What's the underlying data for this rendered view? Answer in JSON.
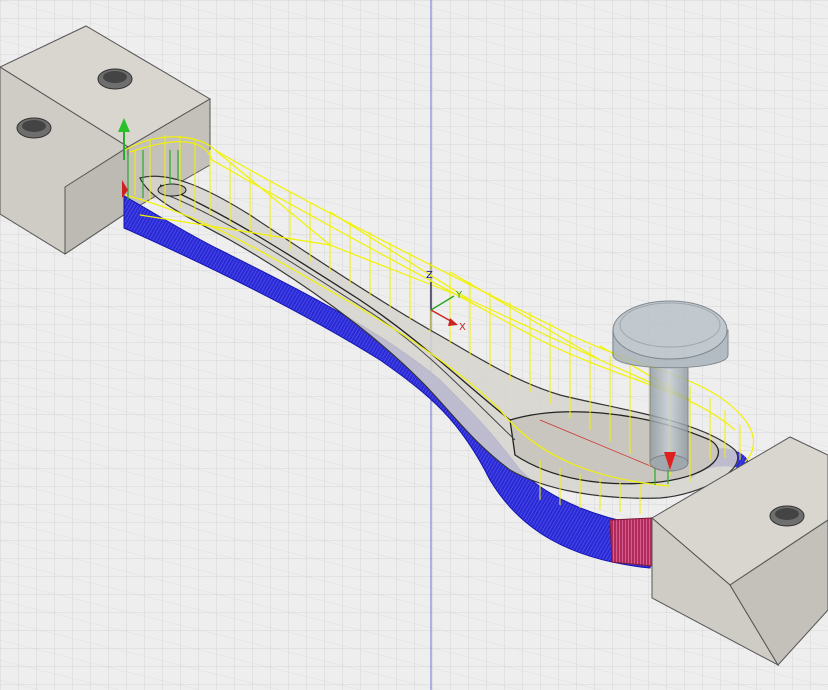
{
  "scene": {
    "background_color": "#eeeeee",
    "grid_color": "#c8c8c8",
    "block_color": "#d5d2cb",
    "toolpath_roughing_color": "#1f1fe0",
    "toolpath_linking_color": "#f2f200",
    "tool_color": "#aeb8c0",
    "finish_stripe_color": "#c0306a"
  },
  "triad": {
    "z_label": "Z",
    "y_label": "Y",
    "x_label": "X",
    "z_color": "#1a1aaa",
    "y_color": "#2aa52a",
    "x_color": "#cc2222"
  },
  "icons": [
    "fixture-block",
    "mounting-hole",
    "cutting-tool",
    "axis-triad",
    "stock-origin-marker",
    "tool-tip-marker"
  ]
}
